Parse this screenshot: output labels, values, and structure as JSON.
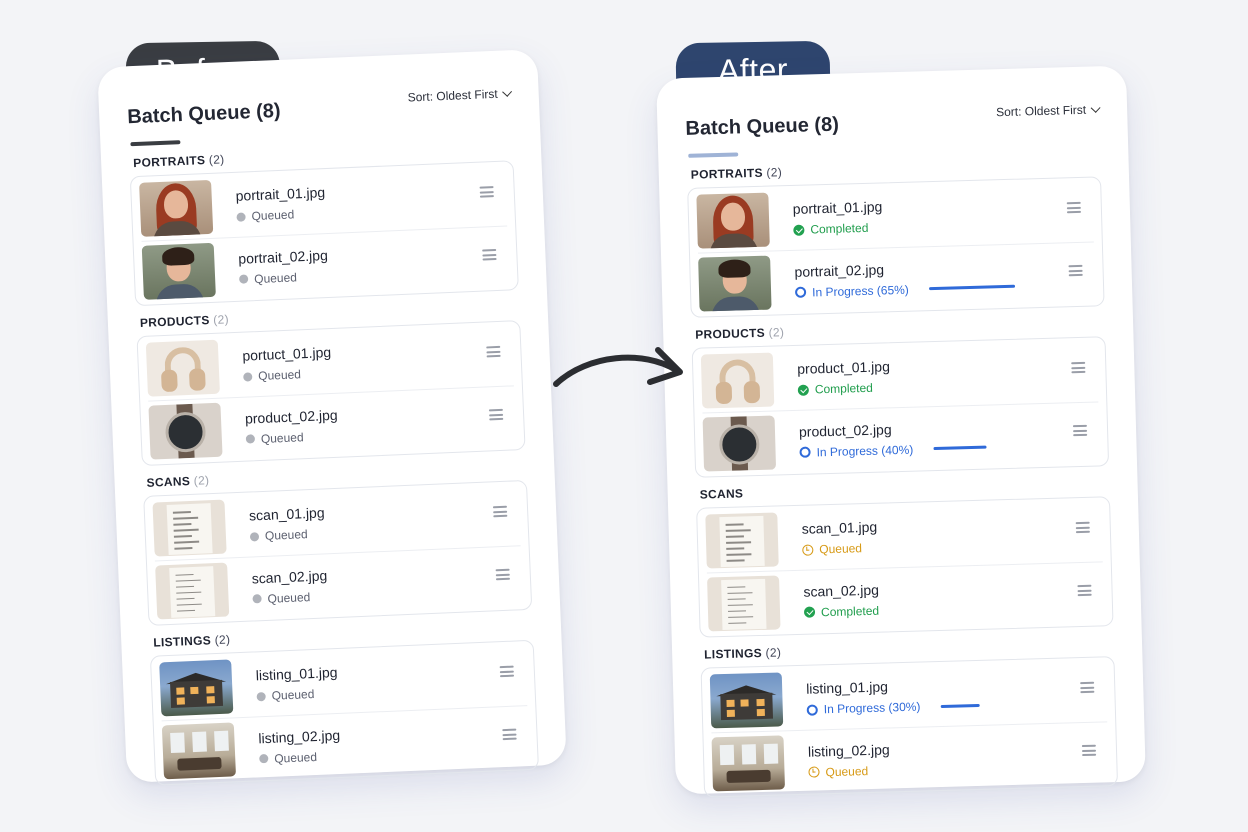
{
  "labels": {
    "before": "Before",
    "after": "After"
  },
  "panels": {
    "before": {
      "title": "Batch Queue (8)",
      "sort": "Sort: Oldest First",
      "groups": [
        {
          "name": "PORTRAITS",
          "count": "(2)",
          "items": [
            {
              "file": "portrait_01.jpg",
              "status": "Queued",
              "state": "queued-grey",
              "thumb": "portrait-woman"
            },
            {
              "file": "portrait_02.jpg",
              "status": "Queued",
              "state": "queued-grey",
              "thumb": "portrait-man"
            }
          ]
        },
        {
          "name": "PRODUCTS",
          "count": "(2)",
          "items": [
            {
              "file": "portuct_01.jpg",
              "status": "Queued",
              "state": "queued-grey",
              "thumb": "headphones"
            },
            {
              "file": "product_02.jpg",
              "status": "Queued",
              "state": "queued-grey",
              "thumb": "watch"
            }
          ]
        },
        {
          "name": "SCANS",
          "count": "(2)",
          "items": [
            {
              "file": "scan_01.jpg",
              "status": "Queued",
              "state": "queued-grey",
              "thumb": "scan"
            },
            {
              "file": "scan_02.jpg",
              "status": "Queued",
              "state": "queued-grey",
              "thumb": "scan"
            }
          ]
        },
        {
          "name": "LISTINGS",
          "count": "(2)",
          "items": [
            {
              "file": "listing_01.jpg",
              "status": "Queued",
              "state": "queued-grey",
              "thumb": "house-exterior"
            },
            {
              "file": "listing_02.jpg",
              "status": "Queued",
              "state": "queued-grey",
              "thumb": "house-interior"
            }
          ]
        }
      ]
    },
    "after": {
      "title": "Batch Queue (8)",
      "sort": "Sort: Oldest First",
      "groups": [
        {
          "name": "PORTRAITS",
          "count": "(2)",
          "items": [
            {
              "file": "portrait_01.jpg",
              "status": "Completed",
              "state": "completed",
              "thumb": "portrait-woman"
            },
            {
              "file": "portrait_02.jpg",
              "status": "In Progress (65%)",
              "state": "progress",
              "progress": 65,
              "thumb": "portrait-man"
            }
          ]
        },
        {
          "name": "PRODUCTS",
          "count": "(2)",
          "items": [
            {
              "file": "product_01.jpg",
              "status": "Completed",
              "state": "completed",
              "thumb": "headphones"
            },
            {
              "file": "product_02.jpg",
              "status": "In Progress (40%)",
              "state": "progress",
              "progress": 40,
              "thumb": "watch"
            }
          ]
        },
        {
          "name": "SCANS",
          "count": "",
          "items": [
            {
              "file": "scan_01.jpg",
              "status": "Queued",
              "state": "queued-amber",
              "thumb": "scan"
            },
            {
              "file": "scan_02.jpg",
              "status": "Completed",
              "state": "completed",
              "thumb": "scan"
            }
          ]
        },
        {
          "name": "LISTINGS",
          "count": "(2)",
          "items": [
            {
              "file": "listing_01.jpg",
              "status": "In Progress (30%)",
              "state": "progress",
              "progress": 30,
              "thumb": "house-exterior"
            },
            {
              "file": "listing_02.jpg",
              "status": "Queued",
              "state": "queued-amber",
              "thumb": "house-interior"
            }
          ]
        }
      ]
    }
  },
  "colors": {
    "completed": "#22a150",
    "in_progress": "#2f6ad9",
    "queued_amber": "#d79a16",
    "queued_grey": "#b0b3ba",
    "before_pill": "#3a3d42",
    "after_pill": "#2e456e"
  },
  "icons": {
    "transition": "curved-arrow-right-icon",
    "drag": "drag-handle-icon",
    "sort": "chevron-down-icon"
  }
}
